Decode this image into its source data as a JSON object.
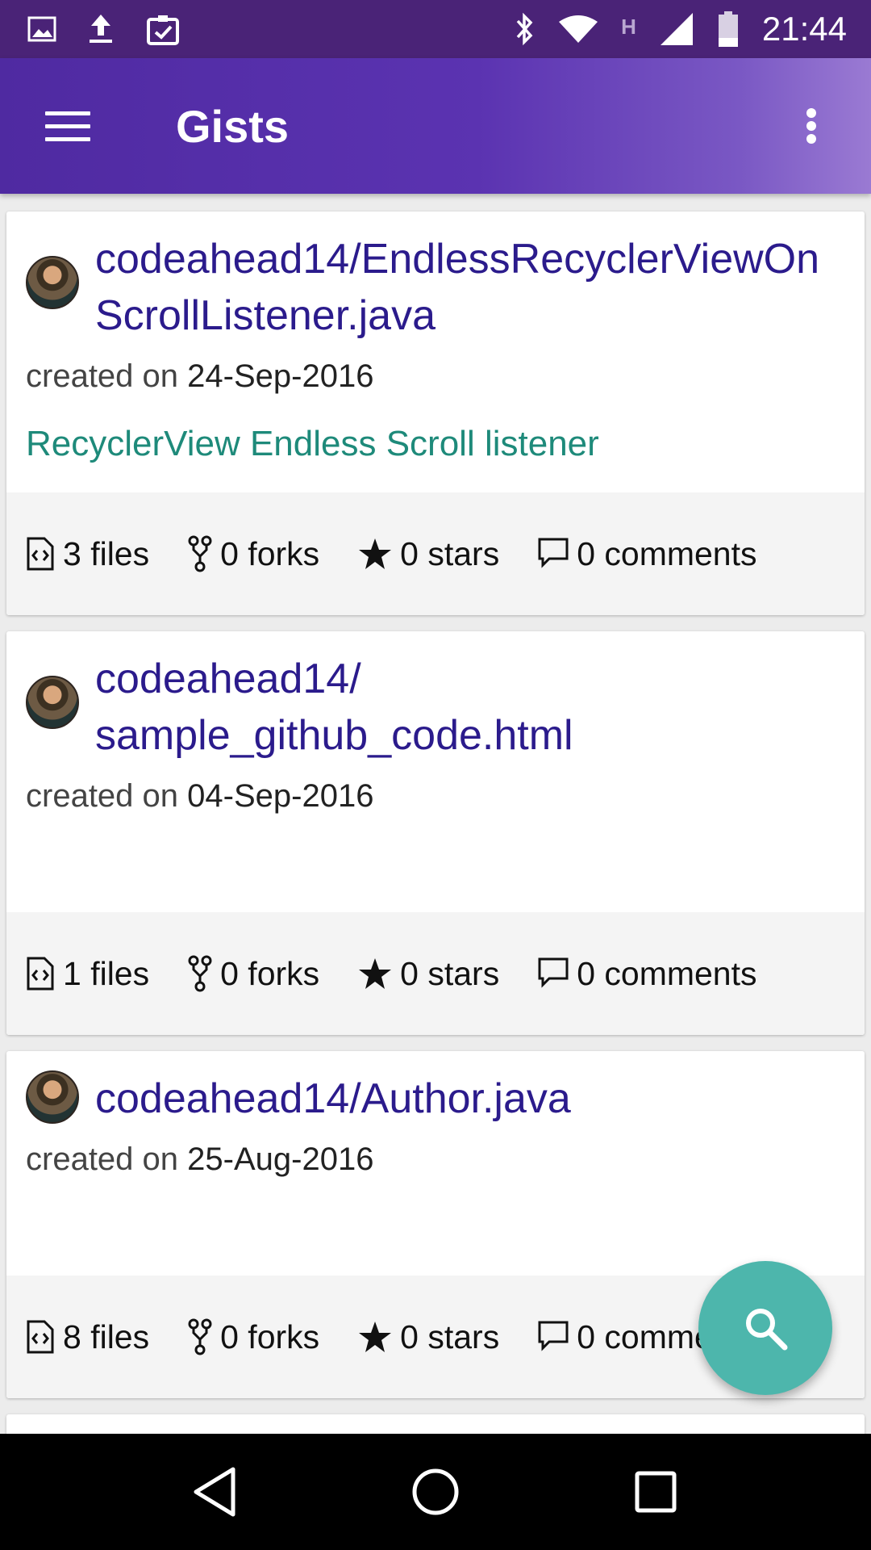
{
  "status_bar": {
    "time": "21:44",
    "network_type": "H",
    "icons": [
      "image-icon",
      "upload-icon",
      "clipboard-check-icon",
      "bluetooth-icon",
      "wifi-icon",
      "signal-icon",
      "battery-icon"
    ]
  },
  "app_bar": {
    "title": "Gists",
    "menu_icon": "hamburger-menu-icon",
    "overflow_icon": "more-vertical-icon"
  },
  "gists": [
    {
      "title": "codeahead14/EndlessRecyclerViewOnScrollListener.java",
      "created_prefix": "created on",
      "created_date": "24-Sep-2016",
      "description": "RecyclerView Endless Scroll listener",
      "files": "3 files",
      "forks": "0 forks",
      "stars": "0 stars",
      "comments": "0 comments"
    },
    {
      "title": "codeahead14/\nsample_github_code.html",
      "created_prefix": "created on",
      "created_date": "04-Sep-2016",
      "description": "",
      "files": "1 files",
      "forks": "0 forks",
      "stars": "0 stars",
      "comments": "0 comments"
    },
    {
      "title": "codeahead14/Author.java",
      "created_prefix": "created on",
      "created_date": "25-Aug-2016",
      "description": "",
      "files": "8 files",
      "forks": "0 forks",
      "stars": "0 stars",
      "comments": "0 comments"
    }
  ],
  "fab": {
    "icon": "search-icon"
  },
  "nav_bar": {
    "icons": [
      "back-icon",
      "home-icon",
      "recents-icon"
    ]
  },
  "colors": {
    "status_bar": "#4a2377",
    "app_bar": "#5b33b1",
    "title_text": "#2b1b8c",
    "description_text": "#1e8a7a",
    "fab": "#4db6ac"
  }
}
